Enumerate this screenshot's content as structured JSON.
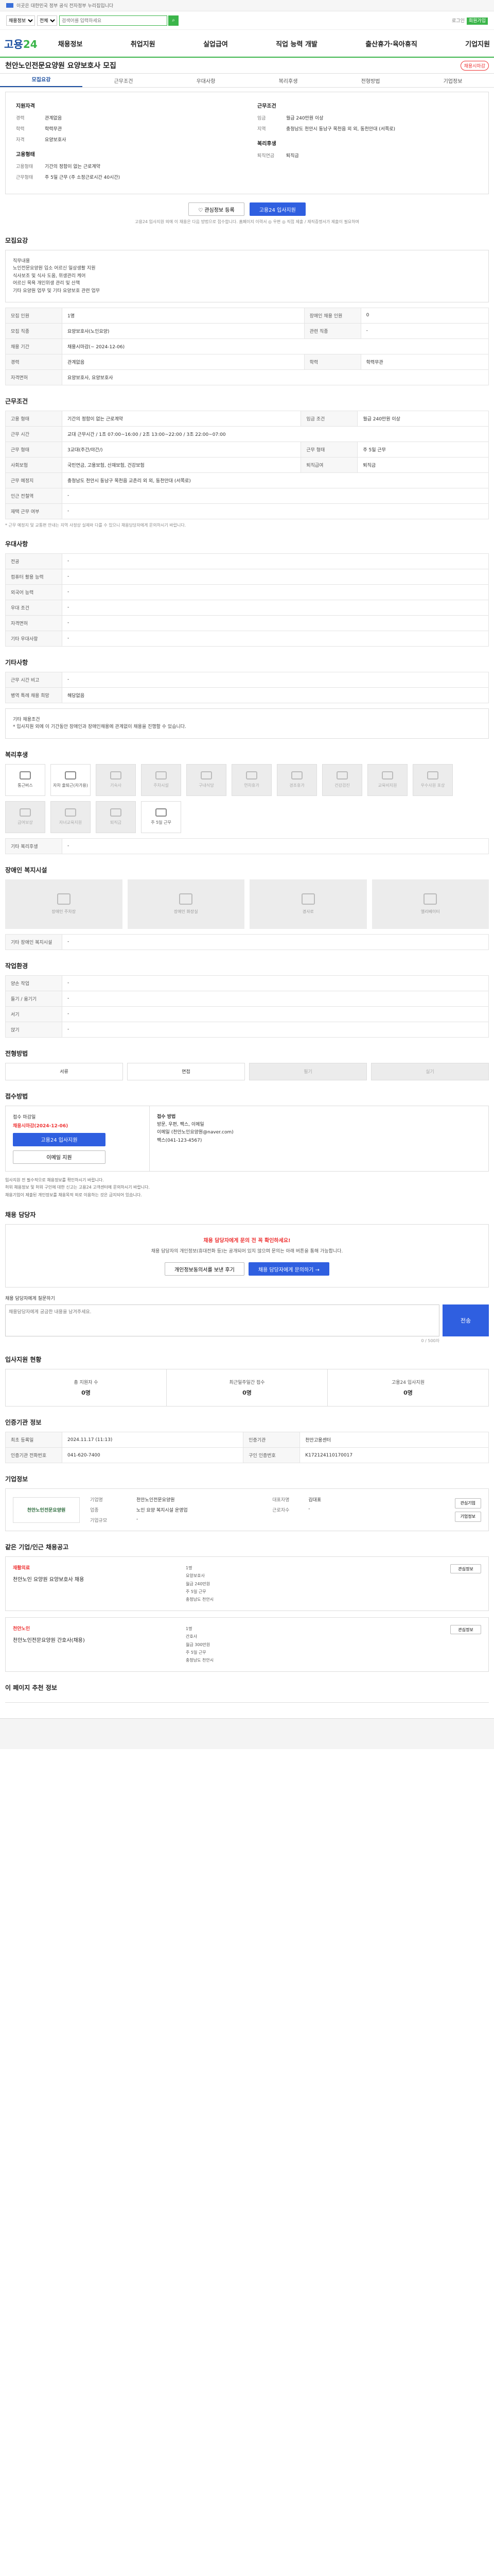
{
  "topbar": {
    "text": "이곳은 대한민국 정부 공식 전자정부 누리집입니다"
  },
  "search": {
    "select1": "채용정보",
    "select2": "전체",
    "placeholder": "검색어를 입력하세요",
    "right": "로그인",
    "right_btn": "회원가입"
  },
  "logo": {
    "main": "고용",
    "accent": "24"
  },
  "gnb": [
    "채용정보",
    "취업지원",
    "실업급여",
    "직업 능력 개발",
    "출산휴가·육아휴직",
    "기업지원"
  ],
  "title": "천안노인전문요양원 요양보호사 모집",
  "title_tag": "채용시마감",
  "tabs": [
    "모집요강",
    "근무조건",
    "우대사항",
    "복리후생",
    "전형방법",
    "기업정보"
  ],
  "summary": {
    "left_title": "지원자격",
    "left": [
      {
        "k": "경력",
        "v": "관계없음"
      },
      {
        "k": "학력",
        "v": "학력무관"
      },
      {
        "k": "자격",
        "v": "요양보호사"
      }
    ],
    "left2_title": "고용형태",
    "left2": [
      {
        "k": "고용형태",
        "v": "기간의 정함이 없는 근로계약"
      },
      {
        "k": "근무형태",
        "v": "주 5일 근무 (주 소정근로시간 40시간)"
      }
    ],
    "right_title": "근무조건",
    "right": [
      {
        "k": "임금",
        "v": "월급 240만원 이상"
      },
      {
        "k": "지역",
        "v": "충청남도 천안시 동남구 목천읍 외 외, 동천안대 (서쪽로)"
      }
    ],
    "right2_title": "복리후생",
    "right2": [
      {
        "k": "퇴직연금",
        "v": "퇴직금"
      }
    ]
  },
  "actions": {
    "fav": "♡ 관심정보 등록",
    "apply": "고용24 입사지원"
  },
  "note": "고용24 입사지원 외에 이 채용은 다음 방법으로 접수합니다. 홈페이지 이력서 ◎ 우편 ◎ 직접 제출 / 재직증명서가 제출이 필요하며",
  "recruit": {
    "h": "모집요강",
    "desc": [
      "직무내용",
      "노인전문요양원 입소 어르신 일상생활 지원",
      "식사보조 및 식사 도움, 위생관리 케어",
      "어르신 목욕 개인위생 관리 및 산책",
      "기타 요양원 업무 및 기타 요양보호 관련 업무"
    ],
    "rows": [
      {
        "k": "모집 인원",
        "v": "1명",
        "k2": "장애인 채용 인원",
        "v2": "0"
      },
      {
        "k": "모집 직종",
        "v": "요양보호사(노인요양)",
        "k2": "관련 직종",
        "v2": "-"
      },
      {
        "k": "채용 기간",
        "v": "채용시마감(~ 2024-12-06)",
        "k2": "",
        "v2": ""
      },
      {
        "k": "경력",
        "v": "관계없음",
        "k2": "학력",
        "v2": "학력무관"
      },
      {
        "k": "자격면허",
        "v": "요양보호사, 요양보호사",
        "k2": "",
        "v2": ""
      }
    ]
  },
  "work": {
    "h": "근무조건",
    "rows": [
      {
        "k": "고용 형태",
        "v": "기간의 정함이 없는 근로계약",
        "k2": "임금 조건",
        "v2": "월급 240만원 이상"
      },
      {
        "k": "근무 시간",
        "v": "교대 근무시간 / 1조 07:00~16:00 / 2조 13:00~22:00 / 3조 22:00~07:00",
        "k2": "",
        "v2": ""
      },
      {
        "k": "근무 형태",
        "v": "3교대(주간/야간/)",
        "k2": "근무 형태",
        "v2": "주 5일 근무"
      },
      {
        "k": "사회보험",
        "v": "국민연금, 고용보험, 산재보험, 건강보험",
        "k2": "퇴직급여",
        "v2": "퇴직금"
      },
      {
        "k": "근무 예정지",
        "v": "충청남도 천안시 동남구 목천읍 교촌리 외 외, 동천안대 (서쪽로)",
        "k2": "",
        "v2": ""
      },
      {
        "k": "인근 전철역",
        "v": "-",
        "k2": "",
        "v2": ""
      },
      {
        "k": "재택 근무 여부",
        "v": "-",
        "k2": "",
        "v2": ""
      }
    ],
    "note": "* 근무 예정지 및 교통편 안내는 지역 사정상 실제와 다를 수 있으니 채용담당자에게 문의하시기 바랍니다."
  },
  "pref": {
    "h": "우대사항",
    "rows": [
      {
        "k": "전공",
        "v": "-"
      },
      {
        "k": "컴퓨터 활용 능력",
        "v": "-"
      },
      {
        "k": "외국어 능력",
        "v": "-"
      },
      {
        "k": "우대 조건",
        "v": "-"
      },
      {
        "k": "자격면허",
        "v": "-"
      },
      {
        "k": "기타 우대사항",
        "v": "-"
      }
    ]
  },
  "other": {
    "h": "기타사항",
    "rows": [
      {
        "k": "근무 시간 비고",
        "v": "-"
      },
      {
        "k": "병역 특례 채용 희망",
        "v": "해당없음"
      }
    ],
    "box": [
      "기타 채용조건",
      "* 입사지원 외에 이 기간동안 장애인과 장애인채용에 관계없이 채용을 진행할 수 있습니다."
    ]
  },
  "welfare": {
    "h": "복리후생",
    "items": [
      "통근버스",
      "자차 출퇴근(자가용)",
      "기숙사",
      "주차시설",
      "구내식당",
      "연차휴가",
      "경조휴가",
      "건강검진",
      "교육비지원",
      "우수사원 포상",
      "급여보상",
      "자녀교육지원",
      "퇴직금",
      "주 5일 근무"
    ],
    "off": [
      2,
      3,
      4,
      5,
      6,
      7,
      8,
      9,
      10,
      11,
      12
    ],
    "other_h": "기타 복리후생",
    "other_v": "-"
  },
  "disabled": {
    "h": "장애인 복지시설",
    "items": [
      "장애인 주차장",
      "장애인 화장실",
      "경사로",
      "엘리베이터"
    ],
    "other_h": "기타 장애인 복지시설",
    "other_v": "-"
  },
  "env": {
    "h": "작업환경",
    "rows": [
      {
        "k": "양손 작업",
        "v": "-",
        "k2": "",
        "v2": ""
      },
      {
        "k": "들기 / 옮기기",
        "v": "-",
        "k2": "",
        "v2": ""
      },
      {
        "k": "서기",
        "v": "-",
        "k2": "",
        "v2": ""
      },
      {
        "k": "앉기",
        "v": "-",
        "k2": "",
        "v2": ""
      }
    ]
  },
  "method": {
    "h": "전형방법",
    "items": [
      "서류",
      "면접",
      "필기",
      "실기"
    ],
    "off": [
      2,
      3
    ]
  },
  "apply": {
    "h": "접수방법",
    "ddl": "접수 마감일",
    "ddl_v": "채용시마감(2024-12-06)",
    "btn": "고용24 입사지원",
    "btn2": "이메일 지원",
    "right_t": "접수 방법",
    "right": [
      "방문, 우편, 팩스, 이메일",
      "이메일 (천안노인요양원@naver.com)",
      "팩스(041-123-4567)"
    ]
  },
  "bullets": [
    "입사지원 전 필수적으로 채용정보를 확인하시기 바랍니다.",
    "허위 채용정보 및 허위 구인에 대한 신고는 고용24 고객센터에 문의하시기 바랍니다.",
    "채용기업이 제출된 개인정보를 채용목적 외로 이용하는 것은 금지되어 있습니다."
  ],
  "qna": {
    "h": "채용 담당자",
    "t": "채용 담당자에게 문의 전 꼭 확인하세요!",
    "d": "채용 담당자의 개인정보(휴대전화 등)는 공개되어 있지 않으며 문의는 아래 버튼을 통해 가능합니다.",
    "b1": "개인정보동의서를 보낸 후기",
    "b2": "채용 담당자에게 문의하기 →",
    "inq_lbl": "채용 담당자에게 질문하기",
    "inq_ph": "채용담당자에게 궁금한 내용을 남겨주세요.",
    "send": "전송",
    "cnt": "0 / 500자"
  },
  "stats": {
    "h": "입사지원 현황",
    "items": [
      {
        "k": "총 지원자 수",
        "v": "0명"
      },
      {
        "k": "최근일주일간 접수",
        "v": "0명"
      },
      {
        "k": "고용24 입사지원",
        "v": "0명"
      }
    ]
  },
  "info": {
    "h": "인증기관 정보",
    "rows": [
      {
        "k": "최초 등록일",
        "v": "2024.11.17 (11:13)",
        "k2": "인증기관",
        "v2": "천안고용센터"
      },
      {
        "k": "인증기관 전화번호",
        "v": "041-620-7400",
        "k2": "구인 인증번호",
        "v2": "K172124110170017"
      }
    ]
  },
  "company": {
    "h": "기업정보",
    "logo": "천안노인전문요양원",
    "name": "천안노인전문요양원",
    "rows": [
      {
        "k": "대표자명",
        "v": "김대표"
      },
      {
        "k": "업종",
        "v": "노인 요양 복지시설 운영업"
      },
      {
        "k": "근로자수",
        "v": "-"
      },
      {
        "k": "기업규모",
        "v": "-"
      }
    ],
    "btn1": "관심기업",
    "btn2": "기업정보"
  },
  "related": {
    "h": "같은 기업/인근 채용공고",
    "items": [
      {
        "co": "재활의료",
        "t": "천안노인 요양원 요양보호사 채용",
        "meta": [
          "1명",
          "요양보호사",
          "월급 240만원",
          "주 5일 근무",
          "충청남도 천안시"
        ]
      },
      {
        "co": "천안노인",
        "t": "천안노인전문요양원 간호사(채용)",
        "meta": [
          "1명",
          "간호사",
          "월급 300만원",
          "주 5일 근무",
          "충청남도 천안시"
        ]
      }
    ],
    "btn": "관심정보"
  },
  "hr": {
    "h": "이 페이지 추천 정보"
  }
}
